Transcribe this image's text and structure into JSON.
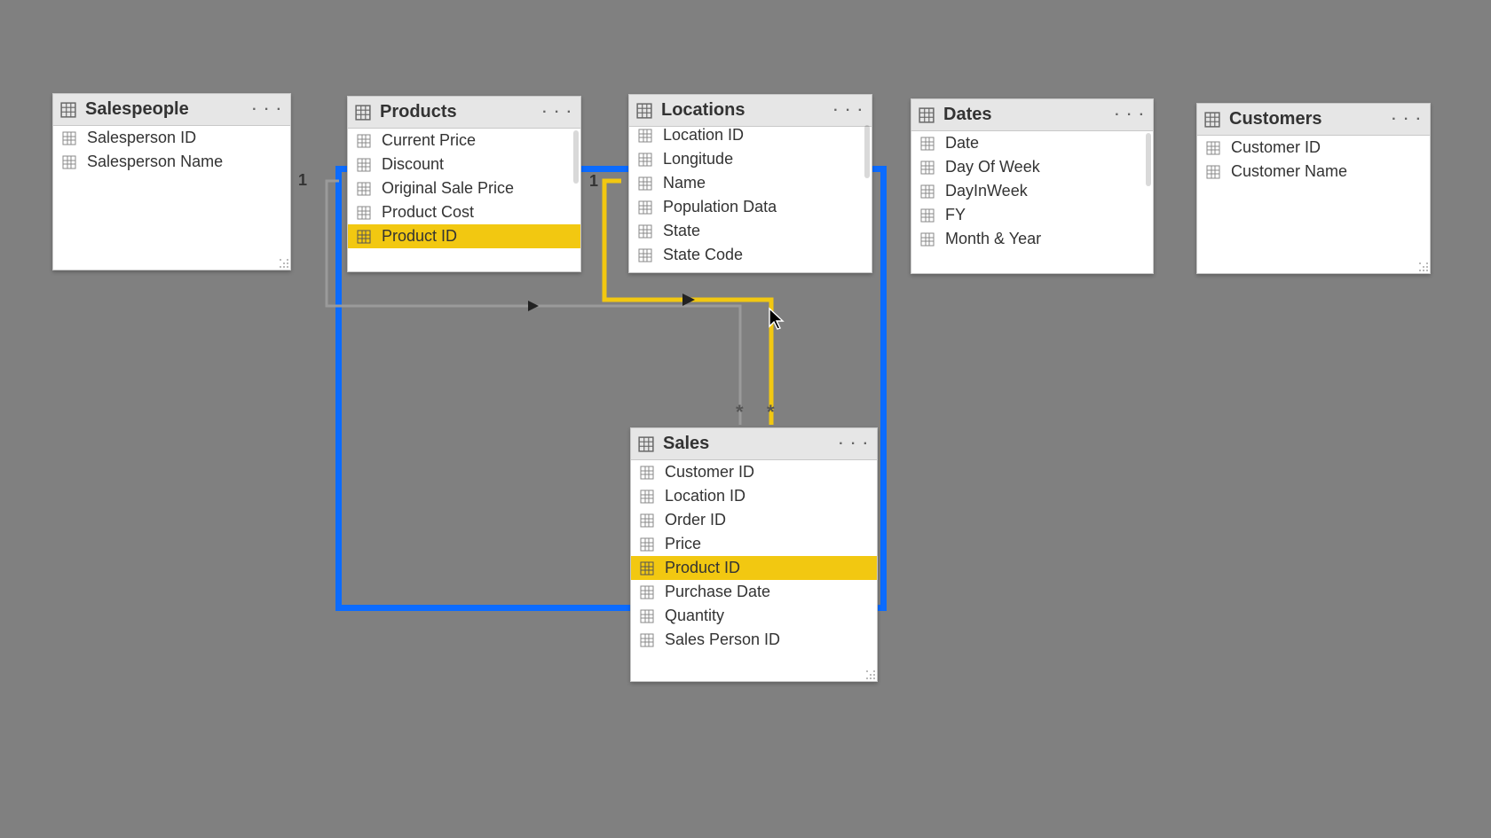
{
  "tables": {
    "salespeople": {
      "title": "Salespeople",
      "fields": [
        "Salesperson ID",
        "Salesperson Name"
      ]
    },
    "products": {
      "title": "Products",
      "fields": [
        "Current Price",
        "Discount",
        "Original Sale Price",
        "Product Cost",
        "Product ID"
      ],
      "selected_index": 4
    },
    "locations": {
      "title": "Locations",
      "fields": [
        "Location ID",
        "Longitude",
        "Name",
        "Population Data",
        "State",
        "State Code"
      ]
    },
    "dates": {
      "title": "Dates",
      "fields": [
        "Date",
        "Day Of Week",
        "DayInWeek",
        "FY",
        "Month & Year"
      ]
    },
    "customers": {
      "title": "Customers",
      "fields": [
        "Customer ID",
        "Customer Name"
      ]
    },
    "sales": {
      "title": "Sales",
      "fields": [
        "Customer ID",
        "Location ID",
        "Order ID",
        "Price",
        "Product ID",
        "Purchase Date",
        "Quantity",
        "Sales Person ID"
      ],
      "selected_index": 4
    }
  },
  "relationships": {
    "products_to_sales": {
      "from_cardinality": "1",
      "to_cardinality": "*"
    },
    "locations_to_sales": {
      "from_cardinality": "1",
      "to_cardinality": "*"
    }
  },
  "chart_data": {
    "type": "entity-relationship-diagram",
    "entities": [
      {
        "name": "Salespeople",
        "fields": [
          "Salesperson ID",
          "Salesperson Name"
        ]
      },
      {
        "name": "Products",
        "fields": [
          "Current Price",
          "Discount",
          "Original Sale Price",
          "Product Cost",
          "Product ID"
        ],
        "highlighted_field": "Product ID"
      },
      {
        "name": "Locations",
        "fields": [
          "Location ID",
          "Longitude",
          "Name",
          "Population Data",
          "State",
          "State Code"
        ]
      },
      {
        "name": "Dates",
        "fields": [
          "Date",
          "Day Of Week",
          "DayInWeek",
          "FY",
          "Month & Year"
        ]
      },
      {
        "name": "Customers",
        "fields": [
          "Customer ID",
          "Customer Name"
        ]
      },
      {
        "name": "Sales",
        "fields": [
          "Customer ID",
          "Location ID",
          "Order ID",
          "Price",
          "Product ID",
          "Purchase Date",
          "Quantity",
          "Sales Person ID"
        ],
        "highlighted_field": "Product ID"
      }
    ],
    "relationships": [
      {
        "from": "Products",
        "to": "Sales",
        "from_cardinality": "1",
        "to_cardinality": "*",
        "highlighted": false
      },
      {
        "from": "Locations",
        "to": "Sales",
        "from_cardinality": "1",
        "to_cardinality": "*",
        "highlighted": true
      }
    ],
    "selection_box_covers": [
      "Products (partial list)",
      "Locations (partial list)",
      "Sales (partial list)",
      "relationship connectors"
    ]
  }
}
